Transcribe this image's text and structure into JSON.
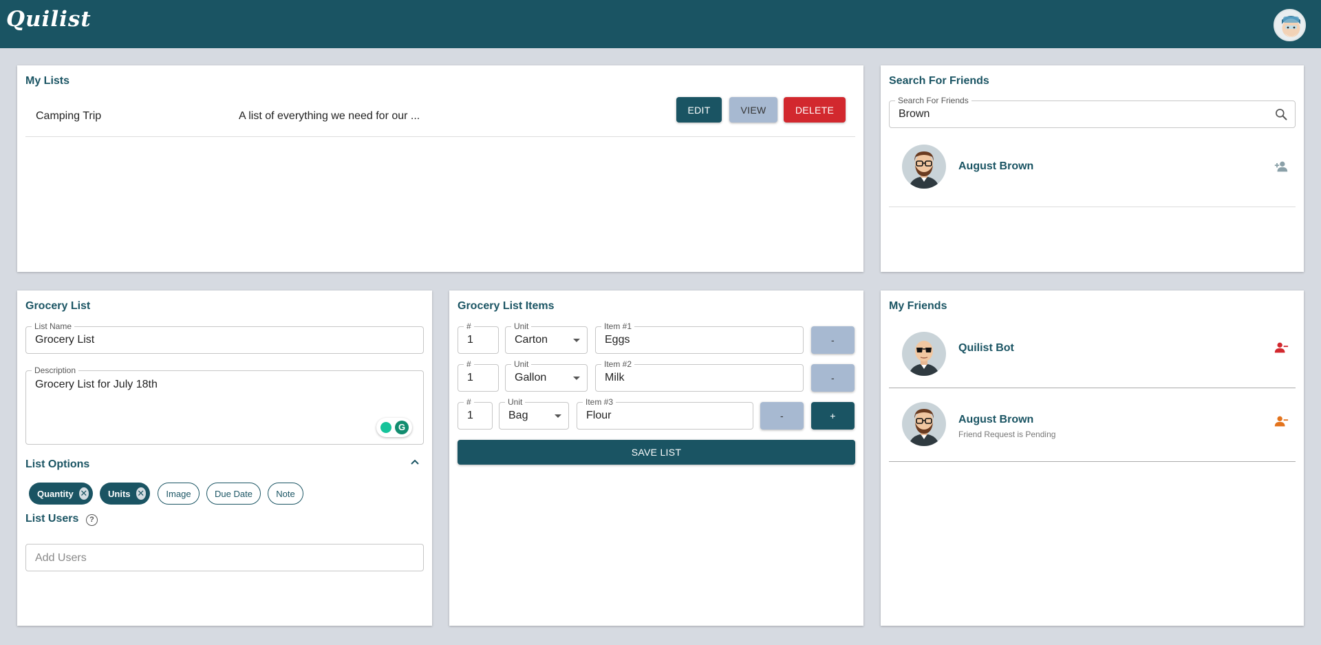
{
  "app": {
    "title": "Quilist"
  },
  "colors": {
    "primary": "#1a5463",
    "accent_light": "#a7b9d1",
    "danger": "#d2282e",
    "background": "#d6dae1",
    "pending": "#e3731c"
  },
  "my_lists": {
    "title": "My Lists",
    "rows": [
      {
        "name": "Camping Trip",
        "description": "A list of everything we need for our ...",
        "edit_label": "EDIT",
        "view_label": "VIEW",
        "delete_label": "DELETE"
      }
    ]
  },
  "search_friends": {
    "title": "Search For Friends",
    "input_label": "Search For Friends",
    "input_value": "Brown",
    "icon": "search-icon",
    "results": [
      {
        "name": "August Brown",
        "action_icon": "person-add-icon"
      }
    ]
  },
  "grocery_list": {
    "title": "Grocery List",
    "name_label": "List Name",
    "name_value": "Grocery List",
    "description_label": "Description",
    "description_value": "Grocery List for July 18th",
    "options_title": "List Options",
    "options": [
      {
        "label": "Quantity",
        "selected": true
      },
      {
        "label": "Units",
        "selected": true
      },
      {
        "label": "Image",
        "selected": false
      },
      {
        "label": "Due Date",
        "selected": false
      },
      {
        "label": "Note",
        "selected": false
      }
    ],
    "users_title": "List Users",
    "users_placeholder": "Add Users"
  },
  "grocery_items": {
    "title": "Grocery List Items",
    "qty_label": "#",
    "unit_label": "Unit",
    "items": [
      {
        "label": "Item #1",
        "qty": "1",
        "unit": "Carton",
        "value": "Eggs"
      },
      {
        "label": "Item #2",
        "qty": "1",
        "unit": "Gallon",
        "value": "Milk"
      },
      {
        "label": "Item #3",
        "qty": "1",
        "unit": "Bag",
        "value": "Flour"
      }
    ],
    "remove_label": "-",
    "add_label": "+",
    "save_label": "SAVE LIST"
  },
  "my_friends": {
    "title": "My Friends",
    "friends": [
      {
        "name": "Quilist Bot",
        "status": "",
        "action_icon": "person-remove-icon"
      },
      {
        "name": "August Brown",
        "status": "Friend Request is Pending",
        "action_icon": "person-remove-icon"
      }
    ]
  }
}
